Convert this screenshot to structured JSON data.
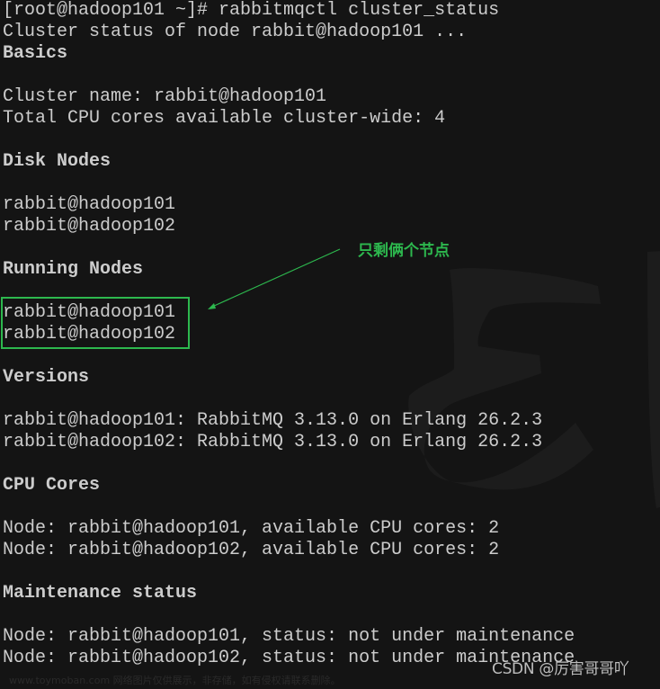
{
  "terminal": {
    "prompt": "[root@hadoop101 ~]# ",
    "command": "rabbitmqctl cluster_status",
    "lines": [
      {
        "text": "[root@hadoop101 ~]# rabbitmqctl cluster_status",
        "heading": false
      },
      {
        "text": "Cluster status of node rabbit@hadoop101 ...",
        "heading": false
      },
      {
        "text": "Basics",
        "heading": true
      },
      {
        "text": "",
        "heading": false
      },
      {
        "text": "Cluster name: rabbit@hadoop101",
        "heading": false
      },
      {
        "text": "Total CPU cores available cluster-wide: 4",
        "heading": false
      },
      {
        "text": "",
        "heading": false
      },
      {
        "text": "Disk Nodes",
        "heading": true
      },
      {
        "text": "",
        "heading": false
      },
      {
        "text": "rabbit@hadoop101",
        "heading": false
      },
      {
        "text": "rabbit@hadoop102",
        "heading": false
      },
      {
        "text": "",
        "heading": false
      },
      {
        "text": "Running Nodes",
        "heading": true
      },
      {
        "text": "",
        "heading": false
      },
      {
        "text": "rabbit@hadoop101",
        "heading": false
      },
      {
        "text": "rabbit@hadoop102",
        "heading": false
      },
      {
        "text": "",
        "heading": false
      },
      {
        "text": "Versions",
        "heading": true
      },
      {
        "text": "",
        "heading": false
      },
      {
        "text": "rabbit@hadoop101: RabbitMQ 3.13.0 on Erlang 26.2.3",
        "heading": false
      },
      {
        "text": "rabbit@hadoop102: RabbitMQ 3.13.0 on Erlang 26.2.3",
        "heading": false
      },
      {
        "text": "",
        "heading": false
      },
      {
        "text": "CPU Cores",
        "heading": true
      },
      {
        "text": "",
        "heading": false
      },
      {
        "text": "Node: rabbit@hadoop101, available CPU cores: 2",
        "heading": false
      },
      {
        "text": "Node: rabbit@hadoop102, available CPU cores: 2",
        "heading": false
      },
      {
        "text": "",
        "heading": false
      },
      {
        "text": "Maintenance status",
        "heading": true
      },
      {
        "text": "",
        "heading": false
      },
      {
        "text": "Node: rabbit@hadoop101, status: not under maintenance",
        "heading": false
      },
      {
        "text": "Node: rabbit@hadoop102, status: not under maintenance",
        "heading": false
      }
    ]
  },
  "annotation": {
    "label": "只剩俩个节点",
    "color": "#2db84e"
  },
  "watermarks": {
    "csdn": "CSDN @厉害哥哥吖",
    "site": "www.toymoban.com 网络图片仅供展示，非存储，如有侵权请联系删除。"
  },
  "colors": {
    "background": "#141414",
    "text": "#cccccc",
    "accent": "#2db84e"
  }
}
